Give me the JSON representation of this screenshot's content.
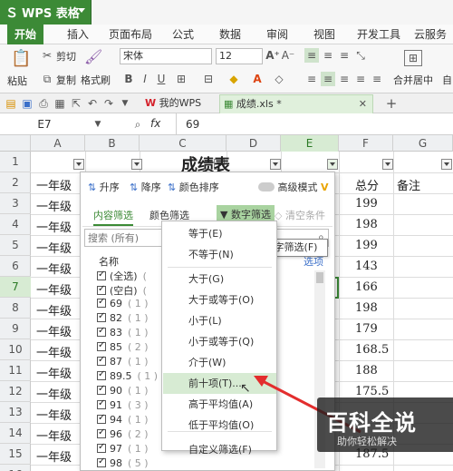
{
  "app": {
    "name": "WPS 表格"
  },
  "ribbon": {
    "tabs": [
      "开始",
      "插入",
      "页面布局",
      "公式",
      "数据",
      "审阅",
      "视图",
      "开发工具",
      "云服务"
    ]
  },
  "toolbar": {
    "cut": "剪切",
    "copy": "复制",
    "paste": "粘贴",
    "format_painter": "格式刷",
    "font_name": "宋体",
    "font_size": "12",
    "merge_center": "合并居中",
    "auto_wrap": "自"
  },
  "doc_tabs": {
    "my_wps": "我的WPS",
    "file": "成绩.xls *"
  },
  "formula_bar": {
    "cell_ref": "E7",
    "fx": "fx",
    "value": "69"
  },
  "grid": {
    "columns": [
      "A",
      "B",
      "C",
      "D",
      "E",
      "F",
      "G"
    ],
    "rows": [
      "1",
      "2",
      "3",
      "4",
      "5",
      "6",
      "7",
      "8",
      "9",
      "10",
      "11",
      "12",
      "13",
      "14",
      "15",
      "16"
    ],
    "title": "成绩表",
    "col_a": [
      "一年级",
      "一年级",
      "一年级",
      "一年级",
      "一年级",
      "一年级",
      "一年级",
      "一年级",
      "一年级",
      "一年级",
      "一年级",
      "一年级",
      "一年级",
      "一年级"
    ],
    "total_header": "总分",
    "note_header": "备注",
    "totals": [
      "199",
      "198",
      "199",
      "143",
      "166",
      "198",
      "179",
      "168.5",
      "188",
      "175.5",
      "",
      "",
      "187.5",
      ""
    ]
  },
  "filter_panel": {
    "sort_asc": "升序",
    "sort_desc": "降序",
    "sort_color": "颜色排序",
    "advanced": "高级模式",
    "tab_content": "内容筛选",
    "tab_color": "颜色筛选",
    "tab_number": "数字筛选",
    "clear": "清空条件",
    "search_placeholder": "搜索 (所有)",
    "list_header": "名称",
    "options": "选项",
    "items": [
      "(全选)",
      "(空白)",
      "69",
      "82",
      "83",
      "85",
      "87",
      "89.5",
      "90",
      "91",
      "94",
      "96",
      "97",
      "98"
    ],
    "counts": [
      "(",
      "(",
      "( 1 )",
      "( 1 )",
      "( 1 )",
      "( 2 )",
      "( 1 )",
      "( 1 )",
      "( 1 )",
      "( 3 )",
      "( 1 )",
      "( 2 )",
      "( 1 )",
      "( 5 )"
    ]
  },
  "number_filter_menu": {
    "items": [
      "等于(E)",
      "不等于(N)",
      "大于(G)",
      "大于或等于(O)",
      "小于(L)",
      "小于或等于(Q)",
      "介于(W)",
      "前十项(T)...",
      "高于平均值(A)",
      "低于平均值(O)",
      "自定义筛选(F)"
    ],
    "tooltip": "数字筛选(F)"
  },
  "watermark": {
    "title": "百科全说",
    "subtitle": "助你轻松解决"
  },
  "colors": {
    "brand_green": "#3c8a36",
    "highlight": "#d7ebd3",
    "arrow_red": "#e32d2d"
  }
}
